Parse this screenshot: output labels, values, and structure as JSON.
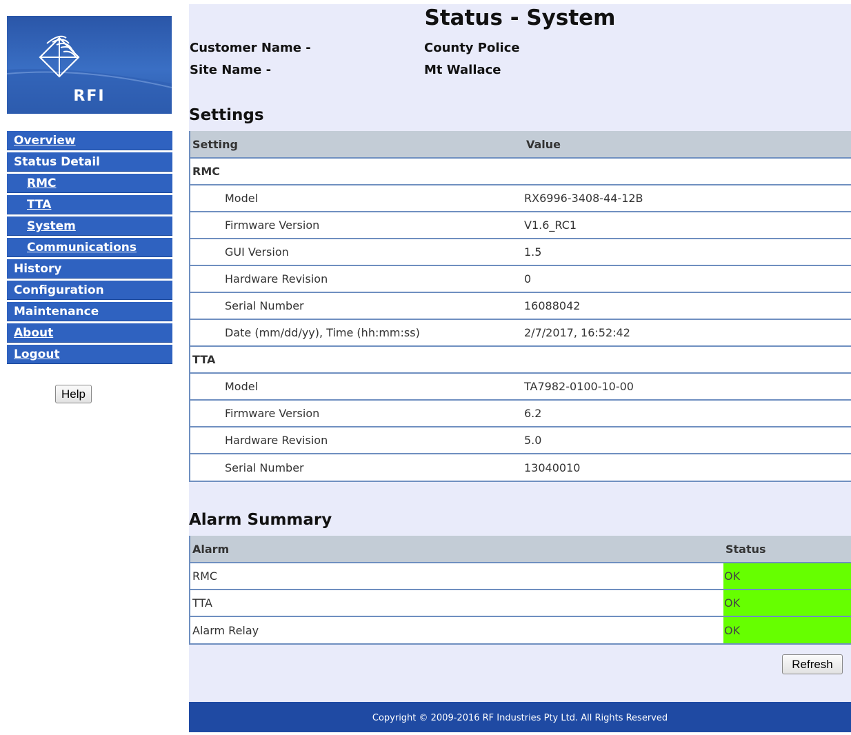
{
  "brand": {
    "logo_text": "RFI"
  },
  "nav": {
    "items": [
      {
        "label": "Overview"
      },
      {
        "label": "Status Detail"
      },
      {
        "label": "RMC"
      },
      {
        "label": "TTA"
      },
      {
        "label": "System"
      },
      {
        "label": "Communications"
      },
      {
        "label": "History"
      },
      {
        "label": "Configuration"
      },
      {
        "label": "Maintenance"
      },
      {
        "label": "About"
      },
      {
        "label": "Logout"
      }
    ],
    "help_label": "Help"
  },
  "header": {
    "title": "Status - System",
    "customer_label": "Customer Name -",
    "customer_value": "County Police",
    "site_label": "Site Name -",
    "site_value": "Mt Wallace"
  },
  "settings": {
    "title": "Settings",
    "columns": [
      "Setting",
      "Value"
    ],
    "groups": [
      {
        "name": "RMC",
        "rows": [
          {
            "setting": "Model",
            "value": "RX6996-3408-44-12B"
          },
          {
            "setting": "Firmware Version",
            "value": "V1.6_RC1"
          },
          {
            "setting": "GUI Version",
            "value": "1.5"
          },
          {
            "setting": "Hardware Revision",
            "value": "0"
          },
          {
            "setting": "Serial Number",
            "value": "16088042"
          },
          {
            "setting": "Date (mm/dd/yy), Time (hh:mm:ss)",
            "value": "2/7/2017, 16:52:42"
          }
        ]
      },
      {
        "name": "TTA",
        "rows": [
          {
            "setting": "Model",
            "value": "TA7982-0100-10-00"
          },
          {
            "setting": "Firmware Version",
            "value": "6.2"
          },
          {
            "setting": "Hardware Revision",
            "value": "5.0"
          },
          {
            "setting": "Serial Number",
            "value": "13040010"
          }
        ]
      }
    ]
  },
  "alarms": {
    "title": "Alarm Summary",
    "columns": [
      "Alarm",
      "Status"
    ],
    "rows": [
      {
        "alarm": "RMC",
        "status": "OK"
      },
      {
        "alarm": "TTA",
        "status": "OK"
      },
      {
        "alarm": "Alarm Relay",
        "status": "OK"
      }
    ],
    "ok_color": "#66ff00"
  },
  "refresh_label": "Refresh",
  "footer": {
    "text": "Copyright © 2009-2016 RF Industries Pty Ltd. All Rights Reserved"
  },
  "colors": {
    "nav_bg": "#2f62c0",
    "content_bg": "#e9ebfa",
    "footer_bg": "#1f4aa3",
    "table_header_bg": "#c3ccd6"
  }
}
